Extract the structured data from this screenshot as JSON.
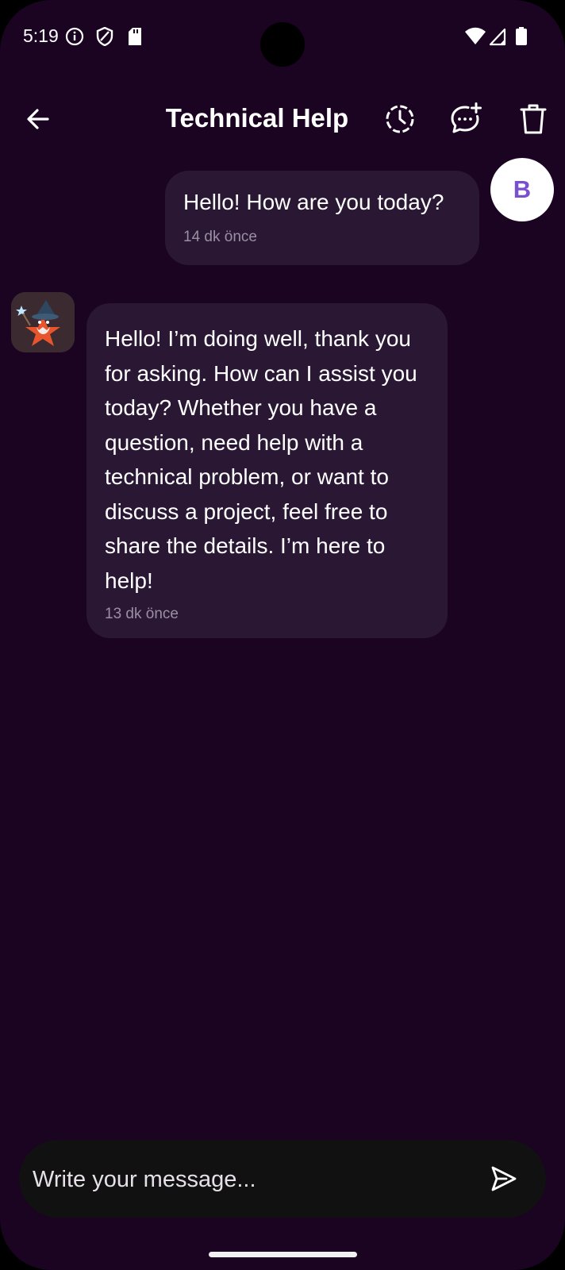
{
  "status_bar": {
    "time": "5:19",
    "icons": [
      "info-icon",
      "shield-icon",
      "sd-card-icon",
      "wifi-icon",
      "signal-icon",
      "battery-icon"
    ]
  },
  "header": {
    "title": "Technical Help",
    "icons": [
      "back-arrow-icon",
      "history-icon",
      "new-chat-icon",
      "trash-icon"
    ]
  },
  "user_avatar": {
    "initial": "B"
  },
  "messages": [
    {
      "sender": "user",
      "text": "Hello! How are you today?",
      "time": "14 dk önce"
    },
    {
      "sender": "bot",
      "text": "Hello! I’m doing well, thank you for asking. How can I assist you today? Whether you have a question, need help with a technical problem, or want to discuss a project, feel free to share the details. I’m here to help!",
      "time": "13 dk önce"
    }
  ],
  "composer": {
    "placeholder": "Write your message...",
    "value": ""
  },
  "colors": {
    "background": "#1b0322",
    "bubble": "#2a1734",
    "input": "#111111",
    "accent": "#7a4ed0"
  }
}
